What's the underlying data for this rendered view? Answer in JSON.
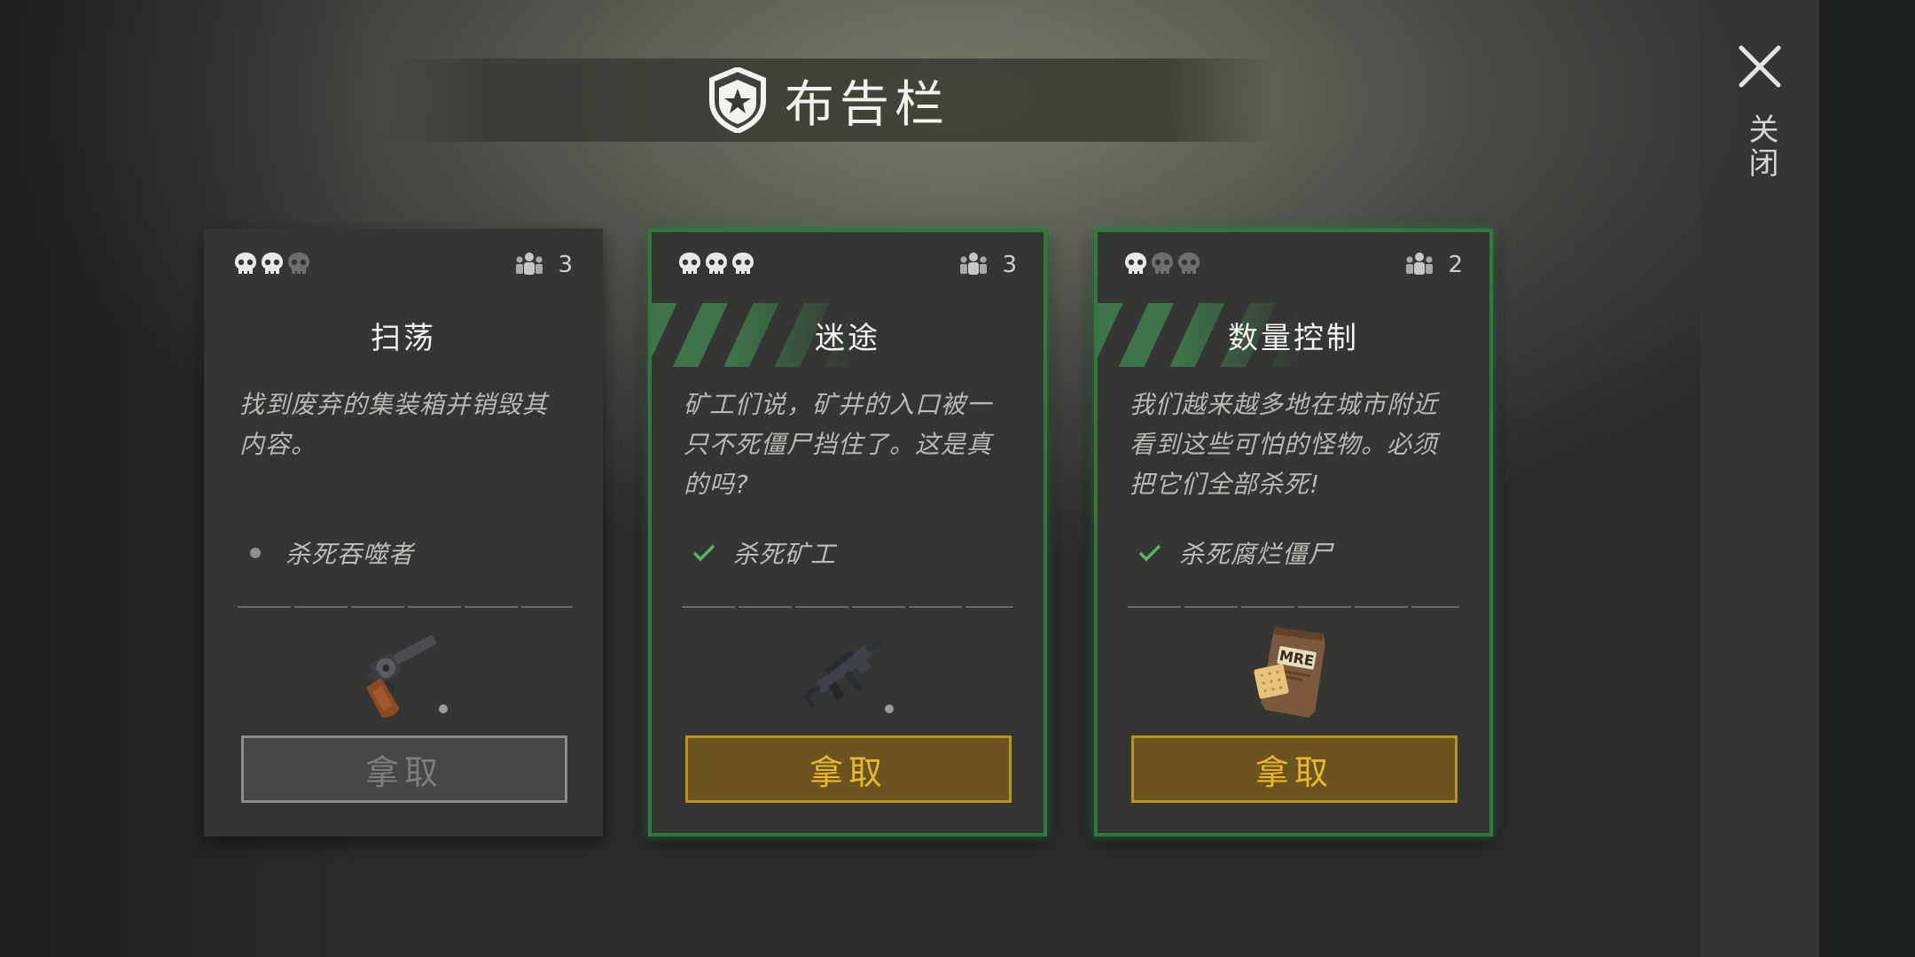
{
  "header": {
    "title": "布告栏",
    "badge_icon": "police-badge-icon"
  },
  "close": {
    "label": "关闭",
    "icon": "close-icon"
  },
  "colors": {
    "accent_green": "#2d7a3b",
    "button_gold": "#e8b72c",
    "button_bg": "#6b541f"
  },
  "cards": [
    {
      "difficulty_level": 2,
      "difficulty_max": 3,
      "players": "3",
      "title": "扫荡",
      "description": "找到废弃的集装箱并销毁其内容。",
      "objective": "杀死吞噬者",
      "objective_done": false,
      "reward_icon": "revolver-icon",
      "claim_label": "拿取",
      "claim_enabled": false
    },
    {
      "difficulty_level": 3,
      "difficulty_max": 3,
      "players": "3",
      "title": "迷途",
      "description": "矿工们说，矿井的入口被一只不死僵尸挡住了。这是真的吗?",
      "objective": "杀死矿工",
      "objective_done": true,
      "reward_icon": "submachine-gun-icon",
      "claim_label": "拿取",
      "claim_enabled": true
    },
    {
      "difficulty_level": 1,
      "difficulty_max": 3,
      "players": "2",
      "title": "数量控制",
      "description": "我们越来越多地在城市附近看到这些可怕的怪物。必须把它们全部杀死!",
      "objective": "杀死腐烂僵尸",
      "objective_done": true,
      "reward_icon": "mre-ration-icon",
      "reward_text": "MRE",
      "claim_label": "拿取",
      "claim_enabled": true
    }
  ]
}
